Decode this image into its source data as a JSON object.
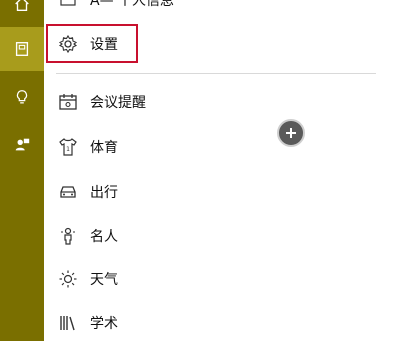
{
  "rail": {
    "items": [
      {
        "icon": "home-icon"
      },
      {
        "icon": "notebook-icon"
      },
      {
        "icon": "lightbulb-icon"
      },
      {
        "icon": "feedback-icon"
      }
    ]
  },
  "menu": {
    "partial_item": {
      "label": "个人信息",
      "prefix": "A—"
    },
    "settings_label": "设置",
    "items": [
      {
        "label": "会议提醒",
        "icon": "calendar-icon"
      },
      {
        "label": "体育",
        "icon": "jersey-icon"
      },
      {
        "label": "出行",
        "icon": "car-icon"
      },
      {
        "label": "名人",
        "icon": "person-icon"
      },
      {
        "label": "天气",
        "icon": "sun-icon"
      },
      {
        "label": "学术",
        "icon": "books-icon"
      }
    ]
  },
  "colors": {
    "rail": "#7a6f00",
    "rail_active": "#a89c1c",
    "highlight": "#c8102e"
  }
}
